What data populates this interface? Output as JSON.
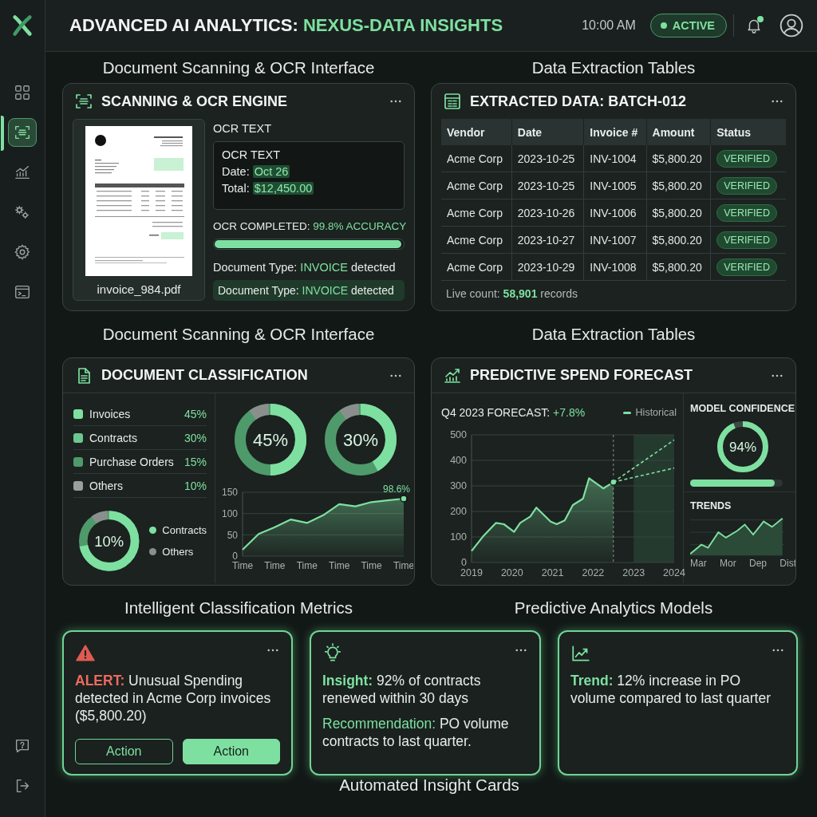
{
  "sidebar": {
    "items": [
      {
        "kind": "dashboard",
        "selected": false
      },
      {
        "kind": "scan",
        "selected": true
      },
      {
        "kind": "analytics",
        "selected": false
      },
      {
        "kind": "models",
        "selected": false
      },
      {
        "kind": "settings",
        "selected": false
      },
      {
        "kind": "terminal",
        "selected": false
      }
    ],
    "bottom_items": [
      {
        "kind": "help"
      },
      {
        "kind": "logout"
      }
    ]
  },
  "header": {
    "title": "ADVANCED AI ANALYTICS: **NEXUS-DATA INSIGHTS**",
    "time": "10:00 AM",
    "status": "ACTIVE",
    "notification_unread": true
  },
  "captions_top": [
    "Document Scanning & OCR Interface",
    "Data Extraction Tables"
  ],
  "scan_panel": {
    "title": "SCANNING & OCR ENGINE",
    "file_name": "invoice_984.pdf",
    "ocr_label": "OCR TEXT",
    "ocr_box": {
      "heading": "OCR TEXT",
      "lines": [
        "Date: **Oct 26**",
        "Total: **$12,450.00**"
      ]
    },
    "progress_label": "OCR COMPLETED: **99.8% ACCURACY**",
    "progress": {
      "level": 0.99
    },
    "doc_type": "Document Type: **INVOICE** detected",
    "doc_type_badge": "Document Type: **INVOICE** detected"
  },
  "table_panel": {
    "title": "EXTRACTED DATA: BATCH-012",
    "columns": [
      "Vendor",
      "Date",
      "Invoice #",
      "Amount",
      "Status"
    ],
    "rows": [
      {
        "cells": [
          "Acme Corp",
          "2023-10-25",
          "INV-1004",
          "$5,800.20"
        ],
        "status": "VERIFIED"
      },
      {
        "cells": [
          "Acme Corp",
          "2023-10-25",
          "INV-1005",
          "$5,800.20"
        ],
        "status": "VERIFIED"
      },
      {
        "cells": [
          "Acme Corp",
          "2023-10-26",
          "INV-1006",
          "$5,800.20"
        ],
        "status": "VERIFIED"
      },
      {
        "cells": [
          "Acme Corp",
          "2023-10-27",
          "INV-1007",
          "$5,800.20"
        ],
        "status": "VERIFIED"
      },
      {
        "cells": [
          "Acme Corp",
          "2023-10-29",
          "INV-1008",
          "$5,800.20"
        ],
        "status": "VERIFIED"
      }
    ],
    "footer": "Live count: **58,901** records"
  },
  "captions_middle": [
    "Document Scanning & OCR Interface",
    "Data Extraction Tables"
  ],
  "classification_panel": {
    "title": "DOCUMENT CLASSIFICATION",
    "legend": [
      {
        "label": "Invoices",
        "value": "45%",
        "color": "#7ee0a0"
      },
      {
        "label": "Contracts",
        "value": "30%",
        "color": "#6cc88e"
      },
      {
        "label": "Purchase Orders",
        "value": "15%",
        "color": "#4f9a6a"
      },
      {
        "label": "Others",
        "value": "10%",
        "color": "#9a9e9c"
      }
    ],
    "donuts": [
      {
        "label": "45%"
      },
      {
        "label": "30%"
      }
    ],
    "small_donut": {
      "label": "10%"
    },
    "small_legend": [
      {
        "label": "Contracts",
        "color": "#7ee0a0"
      },
      {
        "label": "Others",
        "color": "#8a8f8d"
      }
    ],
    "chart_data": {
      "type": "area",
      "categories": [
        "Time",
        null,
        "Time",
        null,
        "Time",
        null,
        "Time",
        null,
        "Time",
        null,
        "Time"
      ],
      "ylim": [
        0,
        150
      ],
      "yticks": [
        0,
        50,
        100,
        150
      ],
      "series": [
        {
          "color": "#7ee0a0",
          "values": [
            15,
            52,
            68,
            86,
            78,
            96,
            122,
            117,
            127,
            131,
            135
          ]
        }
      ],
      "grid": true,
      "annotations": [
        {
          "y": 135,
          "text": "98.6%"
        }
      ]
    }
  },
  "forecast_panel": {
    "title": "PREDICTIVE SPEND FORECAST",
    "headline": "Q4 2023 FORECAST: **+7.8%**",
    "chart_data": {
      "type": "area",
      "x": [
        2019,
        2019.3,
        2019.6,
        2019.8,
        2020.05,
        2020.2,
        2020.45,
        2020.6,
        2020.95,
        2021.1,
        2021.3,
        2021.5,
        2021.75,
        2021.9,
        2022.25,
        2022.5,
        2024
      ],
      "xlim": [
        2019,
        2024
      ],
      "ylim": [
        0,
        500
      ],
      "yticks": [
        0,
        100,
        200,
        300,
        400,
        500
      ],
      "xticks": [
        2019,
        2020,
        2021,
        2022,
        2023,
        2024
      ],
      "series": [
        {
          "name": "Historical",
          "color": "#7ee0a0",
          "values": [
            45,
            105,
            155,
            150,
            120,
            155,
            180,
            215,
            160,
            150,
            165,
            225,
            250,
            330,
            290,
            315,
            null
          ]
        },
        {
          "type": "line",
          "line_style": "dashed",
          "color": "#7ee0a0",
          "values": [
            null,
            null,
            null,
            null,
            null,
            null,
            null,
            null,
            null,
            null,
            null,
            null,
            null,
            null,
            null,
            315,
            480
          ]
        },
        {
          "type": "line",
          "line_style": "dashed",
          "color": "#7ee0a0",
          "values": [
            null,
            null,
            null,
            null,
            null,
            null,
            null,
            null,
            null,
            null,
            null,
            null,
            null,
            null,
            null,
            315,
            370
          ]
        }
      ],
      "grid": true,
      "ref_lines": [
        {
          "axis": "x",
          "value": 2022.5
        }
      ],
      "bands": [
        {
          "axis": "x",
          "from": 2023,
          "to": 2024
        }
      ]
    },
    "confidence": {
      "label": "MODEL CONFIDENCE",
      "value": "94%",
      "bar": {
        "level": 0.91
      }
    },
    "trends": {
      "title": "TRENDS",
      "labels": [
        "Mar",
        "Mor",
        "Dep",
        "Dist"
      ]
    }
  },
  "captions_lower": [
    "Intelligent Classification Metrics",
    "Predictive Analytics Models"
  ],
  "insight_cards": [
    {
      "kind": "alert",
      "paragraphs": [
        "**ALERT:** Unusual Spending detected in Acme Corp invoices ($5,800.20)"
      ],
      "buttons": [
        {
          "label": "Action",
          "kind": "secondary"
        },
        {
          "label": "Action",
          "kind": "primary"
        }
      ]
    },
    {
      "kind": "insight",
      "paragraphs": [
        "**Insight:** 92% of contracts renewed within 30 days",
        "*Recommendation:* PO volume contracts to last quarter."
      ]
    },
    {
      "kind": "trend",
      "paragraphs": [
        "**Trend:** 12% increase in PO volume compared to last quarter"
      ]
    }
  ],
  "caption_bottom": "Automated Insight Cards"
}
